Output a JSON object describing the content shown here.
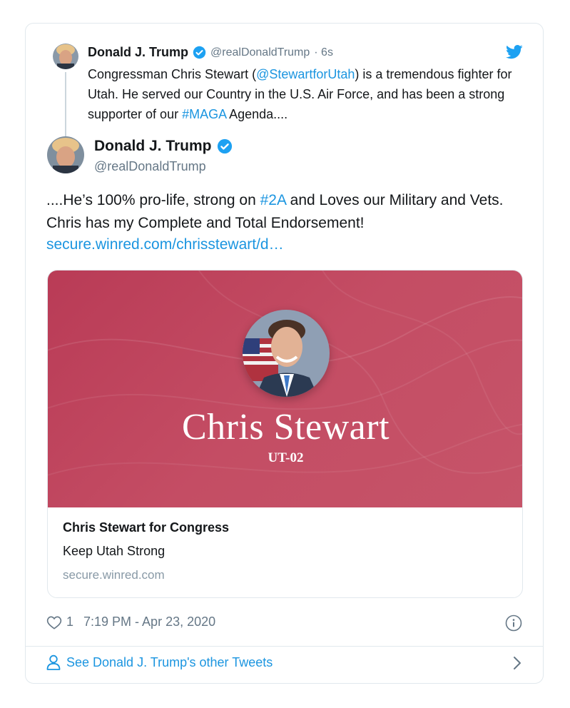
{
  "quoted_tweet": {
    "author_name": "Donald J. Trump",
    "author_handle": "@realDonaldTrump",
    "timestamp": "· 6s",
    "text_part1": "Congressman Chris Stewart (",
    "mention": "@StewartforUtah",
    "text_part2": ") is a tremendous fighter for Utah. He served our Country in the U.S. Air Force, and has been a strong supporter of our ",
    "hashtag": "#MAGA",
    "text_part3": " Agenda...."
  },
  "tweet": {
    "author_name": "Donald J. Trump",
    "author_handle": "@realDonaldTrump",
    "text_part1": "....He’s 100% pro-life, strong on ",
    "hashtag": "#2A",
    "text_part2": " and Loves our Military and Vets. Chris has my Complete and Total Endorsement!",
    "link": "secure.winred.com/chrisstewart/d…"
  },
  "link_card": {
    "image_name": "Chris Stewart",
    "image_district": "UT-02",
    "title": "Chris Stewart for Congress",
    "description": "Keep Utah Strong",
    "domain": "secure.winred.com"
  },
  "stats": {
    "like_count": "1",
    "time": "7:19 PM - Apr 23, 2020"
  },
  "footer": {
    "link_text": "See Donald J. Trump's other Tweets"
  },
  "icons": {
    "verified": "verified-badge-icon",
    "bird": "twitter-bird-icon",
    "heart": "heart-icon",
    "info": "info-icon",
    "person": "person-icon",
    "chevron": "chevron-right-icon"
  },
  "colors": {
    "link": "#1b95e0",
    "card_red": "#c0475f",
    "muted": "#657786"
  }
}
